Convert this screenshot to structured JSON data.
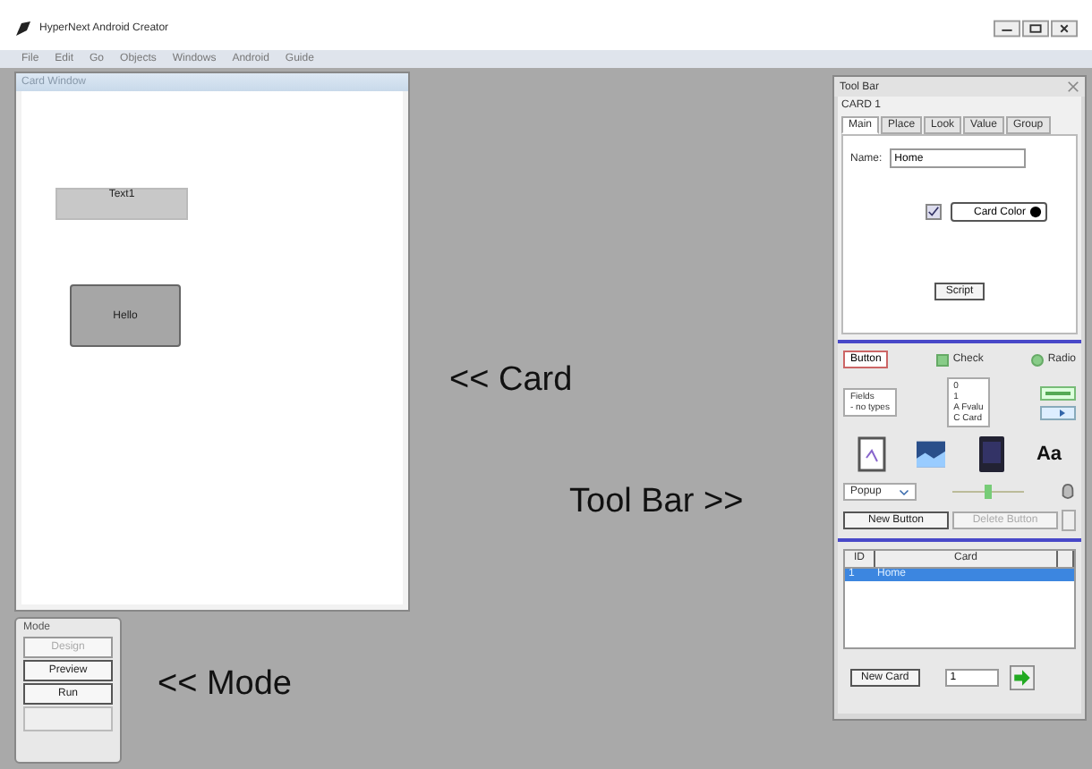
{
  "window": {
    "title": "HyperNext Android Creator"
  },
  "menu": [
    "File",
    "Edit",
    "Go",
    "Objects",
    "Windows",
    "Android",
    "Guide"
  ],
  "card_window": {
    "title": "Card Window",
    "widgets": [
      {
        "kind": "field",
        "label": "Text1"
      },
      {
        "kind": "button",
        "label": "Hello"
      }
    ]
  },
  "notes": [
    {
      "kind": "card",
      "text": "<< Card"
    },
    {
      "kind": "toolbar",
      "text": "Tool Bar >>"
    },
    {
      "kind": "mode",
      "text": "<< Mode"
    }
  ],
  "mode_window": {
    "title": "Mode",
    "buttons": [
      {
        "label": "Design",
        "disabled": true
      },
      {
        "label": "Preview",
        "disabled": false
      },
      {
        "label": "Run",
        "disabled": false
      }
    ]
  },
  "toolbar": {
    "title": "Tool Bar",
    "card_label": "CARD 1",
    "tabs": [
      {
        "label": "Main",
        "selected": true
      },
      {
        "label": "Place",
        "selected": false
      },
      {
        "label": "Look",
        "selected": false
      },
      {
        "label": "Value",
        "selected": false
      },
      {
        "label": "Group",
        "selected": false
      }
    ],
    "name_label": "Name:",
    "name_value": "Home",
    "card_color": {
      "checked": true,
      "label": "Card Color"
    },
    "script_button": "Script",
    "palette": {
      "button": "Button",
      "check": {
        "label": "Check",
        "checked": true
      },
      "radio": {
        "label": "Radio",
        "selected": true
      },
      "fields": [
        "Fields",
        "- no types"
      ],
      "grid": [
        "0",
        "1",
        "A Fvalu",
        "C Card"
      ],
      "text_tool": "Aa",
      "popup": "Popup"
    },
    "new_button": {
      "label": "New Button",
      "disabled": false
    },
    "delete_button": {
      "label": "Delete Button",
      "disabled": true
    },
    "table": {
      "columns": [
        "ID",
        "Card"
      ],
      "rows": [
        {
          "cells": [
            "1",
            "Home"
          ],
          "selected": true
        }
      ]
    },
    "new_card": "New Card",
    "card_number": "1"
  }
}
